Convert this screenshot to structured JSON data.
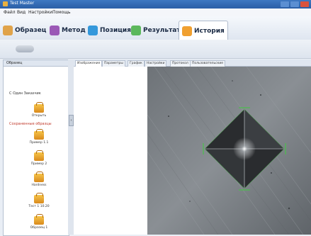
{
  "window": {
    "title": "Test Master"
  },
  "menu": [
    "Файл",
    "Вид",
    "Настройки",
    "Помощь"
  ],
  "ribbon_tabs": [
    {
      "label": "Образец",
      "icon": "sample-icon",
      "color": "#e0a34a"
    },
    {
      "label": "Метод",
      "icon": "method-icon",
      "color": "#9b59b6"
    },
    {
      "label": "Позиция",
      "icon": "position-icon",
      "color": "#3498db"
    },
    {
      "label": "Результат",
      "icon": "result-icon",
      "color": "#5cb85c"
    },
    {
      "label": "История",
      "icon": "history-icon",
      "color": "#f0a030"
    }
  ],
  "active_tab": "История",
  "left_panel": {
    "header": "Образец",
    "section_open": "С Один Заказчик",
    "open_label": "Открыть",
    "section_saved": "Сохраненные образцы",
    "items": [
      "Пример 1.1",
      "Пример 2",
      "Hardness",
      "Тест 1 10.20",
      "Образец 1"
    ]
  },
  "subtabs": [
    "Изображение",
    "Параметры",
    "График",
    "Настройки",
    "Протокол",
    "Пользовательские"
  ],
  "colors": {
    "accent": "#3e78c2",
    "marker": "#49c04a"
  }
}
